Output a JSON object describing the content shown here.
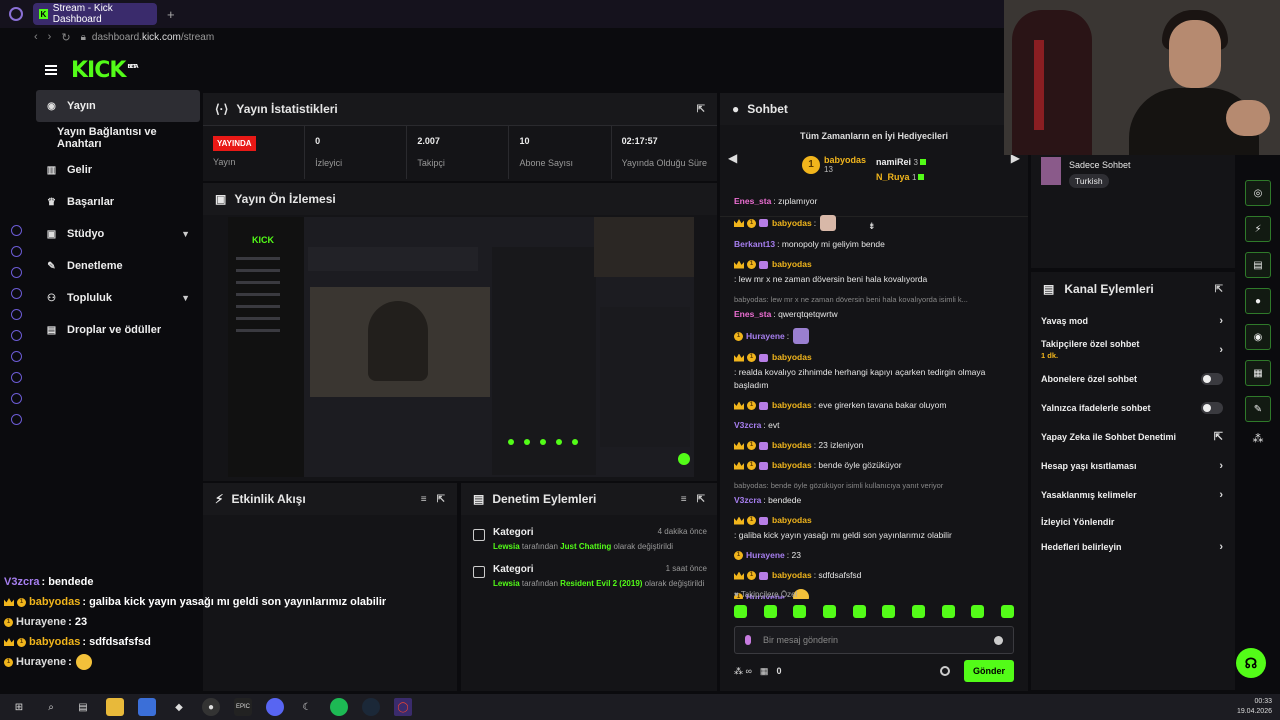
{
  "browser": {
    "tab_title": "Stream - Kick Dashboard",
    "tab_fav": "K",
    "url_prefix": "dashboard.",
    "url_domain": "kick.com",
    "url_path": "/stream"
  },
  "header": {
    "logo": "KICK",
    "logo_beta": "BETA"
  },
  "sidebar": {
    "items": [
      {
        "label": "Yayın",
        "icon": "broadcast-icon"
      },
      {
        "label": "Yayın Bağlantısı ve Anahtarı"
      },
      {
        "label": "Gelir",
        "icon": "chart-icon"
      },
      {
        "label": "Başarılar",
        "icon": "trophy-icon"
      },
      {
        "label": "Stüdyo",
        "icon": "studio-icon"
      },
      {
        "label": "Denetleme",
        "icon": "wrench-icon"
      },
      {
        "label": "Topluluk",
        "icon": "community-icon"
      },
      {
        "label": "Droplar ve ödüller",
        "icon": "gift-icon"
      }
    ]
  },
  "stats": {
    "title": "Yayın İstatistikleri",
    "live_badge": "YAYINDA",
    "live_label": "Yayın",
    "items": [
      {
        "value": "0",
        "label": "İzleyici"
      },
      {
        "value": "2.007",
        "label": "Takipçi"
      },
      {
        "value": "10",
        "label": "Abone Sayısı"
      },
      {
        "value": "02:17:57",
        "label": "Yayında Olduğu Süre"
      }
    ]
  },
  "preview": {
    "title": "Yayın Ön İzlemesi"
  },
  "activity": {
    "title": "Etkinlik Akışı"
  },
  "moderation": {
    "title": "Denetim Eylemleri",
    "items": [
      {
        "title": "Kategori",
        "time": "4 dakika önce",
        "user": "Lewsia",
        "mid": " tarafından ",
        "cat": "Just Chatting",
        "end": " olarak değiştirildi"
      },
      {
        "title": "Kategori",
        "time": "1 saat önce",
        "user": "Lewsia",
        "mid": " tarafından ",
        "cat": "Resident Evil 2 (2019)",
        "end": " olarak değiştirildi"
      }
    ]
  },
  "chat": {
    "title": "Sohbet",
    "gifters_title": "Tüm Zamanların en İyi Hediyecileri",
    "top_gifter": {
      "name": "babyodas",
      "count": "13"
    },
    "gifters": [
      {
        "name": "namiRei",
        "count": "3"
      },
      {
        "name": "N_Ruya",
        "count": "1"
      }
    ],
    "messages": [
      {
        "user": "Enes_sta",
        "text": ": zıplamıyor",
        "color": "#ee6fd4"
      },
      {
        "user": "babyodas",
        "text": ":",
        "color": "#f1b51c",
        "badges": true,
        "emote": true
      },
      {
        "user": "Berkant13",
        "text": ": monopoly mi geliyim bende",
        "color": "#a77ff0"
      },
      {
        "user": "babyodas",
        "text": ": lew mr x ne zaman döversin beni hala kovalıyorda",
        "color": "#f1b51c",
        "badges": true
      },
      {
        "reply": "babyodas: lew mr x ne zaman döversin beni hala kovalıyorda isimli k...",
        "user": "Enes_sta",
        "text": ": qwerqtqetqwrtw",
        "color": "#ee6fd4"
      },
      {
        "user": "Hurayene",
        "text": ":",
        "color": "#a77ff0",
        "coin": true,
        "emote": true
      },
      {
        "user": "babyodas",
        "text": ": realda kovalıyo zihnimde herhangi kapıyı açarken tedirgin olmaya başladım",
        "color": "#f1b51c",
        "badges": true
      },
      {
        "user": "babyodas",
        "text": ": eve girerken tavana bakar oluyom",
        "color": "#f1b51c",
        "badges": true
      },
      {
        "user": "V3zcra",
        "text": ": evt",
        "color": "#a77ff0"
      },
      {
        "user": "babyodas",
        "text": ": 23 izleniyon",
        "color": "#f1b51c",
        "badges": true
      },
      {
        "user": "babyodas",
        "text": ": bende öyle gözüküyor",
        "color": "#f1b51c",
        "badges": true
      },
      {
        "reply": "babyodas: bende öyle gözüküyor isimli kullanıcıya yanıt veriyor",
        "user": "V3zcra",
        "text": ": bendede",
        "color": "#a77ff0"
      },
      {
        "user": "babyodas",
        "text": ": galiba kick yayın yasağı mı geldi son yayınlarımız olabilir",
        "color": "#f1b51c",
        "badges": true
      },
      {
        "user": "Hurayene",
        "text": ": 23",
        "color": "#a77ff0",
        "coin": true
      },
      {
        "user": "babyodas",
        "text": ": sdfdsafsfsd",
        "color": "#f1b51c",
        "badges": true
      },
      {
        "user": "Hurayene",
        "text": ":",
        "color": "#a77ff0",
        "coin": true,
        "emote": true
      }
    ],
    "quick_label": "Takipçilere Özel",
    "input_placeholder": "Bir mesaj gönderin",
    "footer_count": "0",
    "send_label": "Gönder"
  },
  "chat_settings": {
    "label": "Sadece Sohbet",
    "lang": "Turkish"
  },
  "channel_actions": {
    "title": "Kanal Eylemleri",
    "items": [
      {
        "label": "Yavaş mod",
        "kind": "arrow"
      },
      {
        "label": "Takipçilere özel sohbet",
        "sub": "1 dk.",
        "kind": "arrow"
      },
      {
        "label": "Abonelere özel sohbet",
        "kind": "toggle"
      },
      {
        "label": "Yalnızca ifadelerle sohbet",
        "kind": "toggle"
      },
      {
        "label": "Yapay Zeka ile Sohbet Denetimi",
        "kind": "ext"
      },
      {
        "label": "Hesap yaşı kısıtlaması",
        "kind": "arrow"
      },
      {
        "label": "Yasaklanmış kelimeler",
        "kind": "arrow"
      },
      {
        "label": "İzleyici Yönlendir",
        "kind": "none"
      },
      {
        "label": "Hedefleri belirleyin",
        "kind": "arrow"
      }
    ]
  },
  "overlay": {
    "lines": [
      {
        "user": "V3zcra",
        "text": " : bendede"
      },
      {
        "user": "babyodas",
        "text": " : galiba kick yayın yasağı mı geldi son yayınlarımız olabilir"
      },
      {
        "user": "Hurayene",
        "text": " : 23"
      },
      {
        "user": "babyodas",
        "text": " : sdfdsafsfsd"
      },
      {
        "user": "Hurayene",
        "text": " :"
      }
    ]
  },
  "taskbar": {
    "time": "00:33",
    "date": "19.04.2026"
  },
  "colors": {
    "accent": "#53fc18",
    "live": "#e91916",
    "gold": "#f1b51c"
  }
}
